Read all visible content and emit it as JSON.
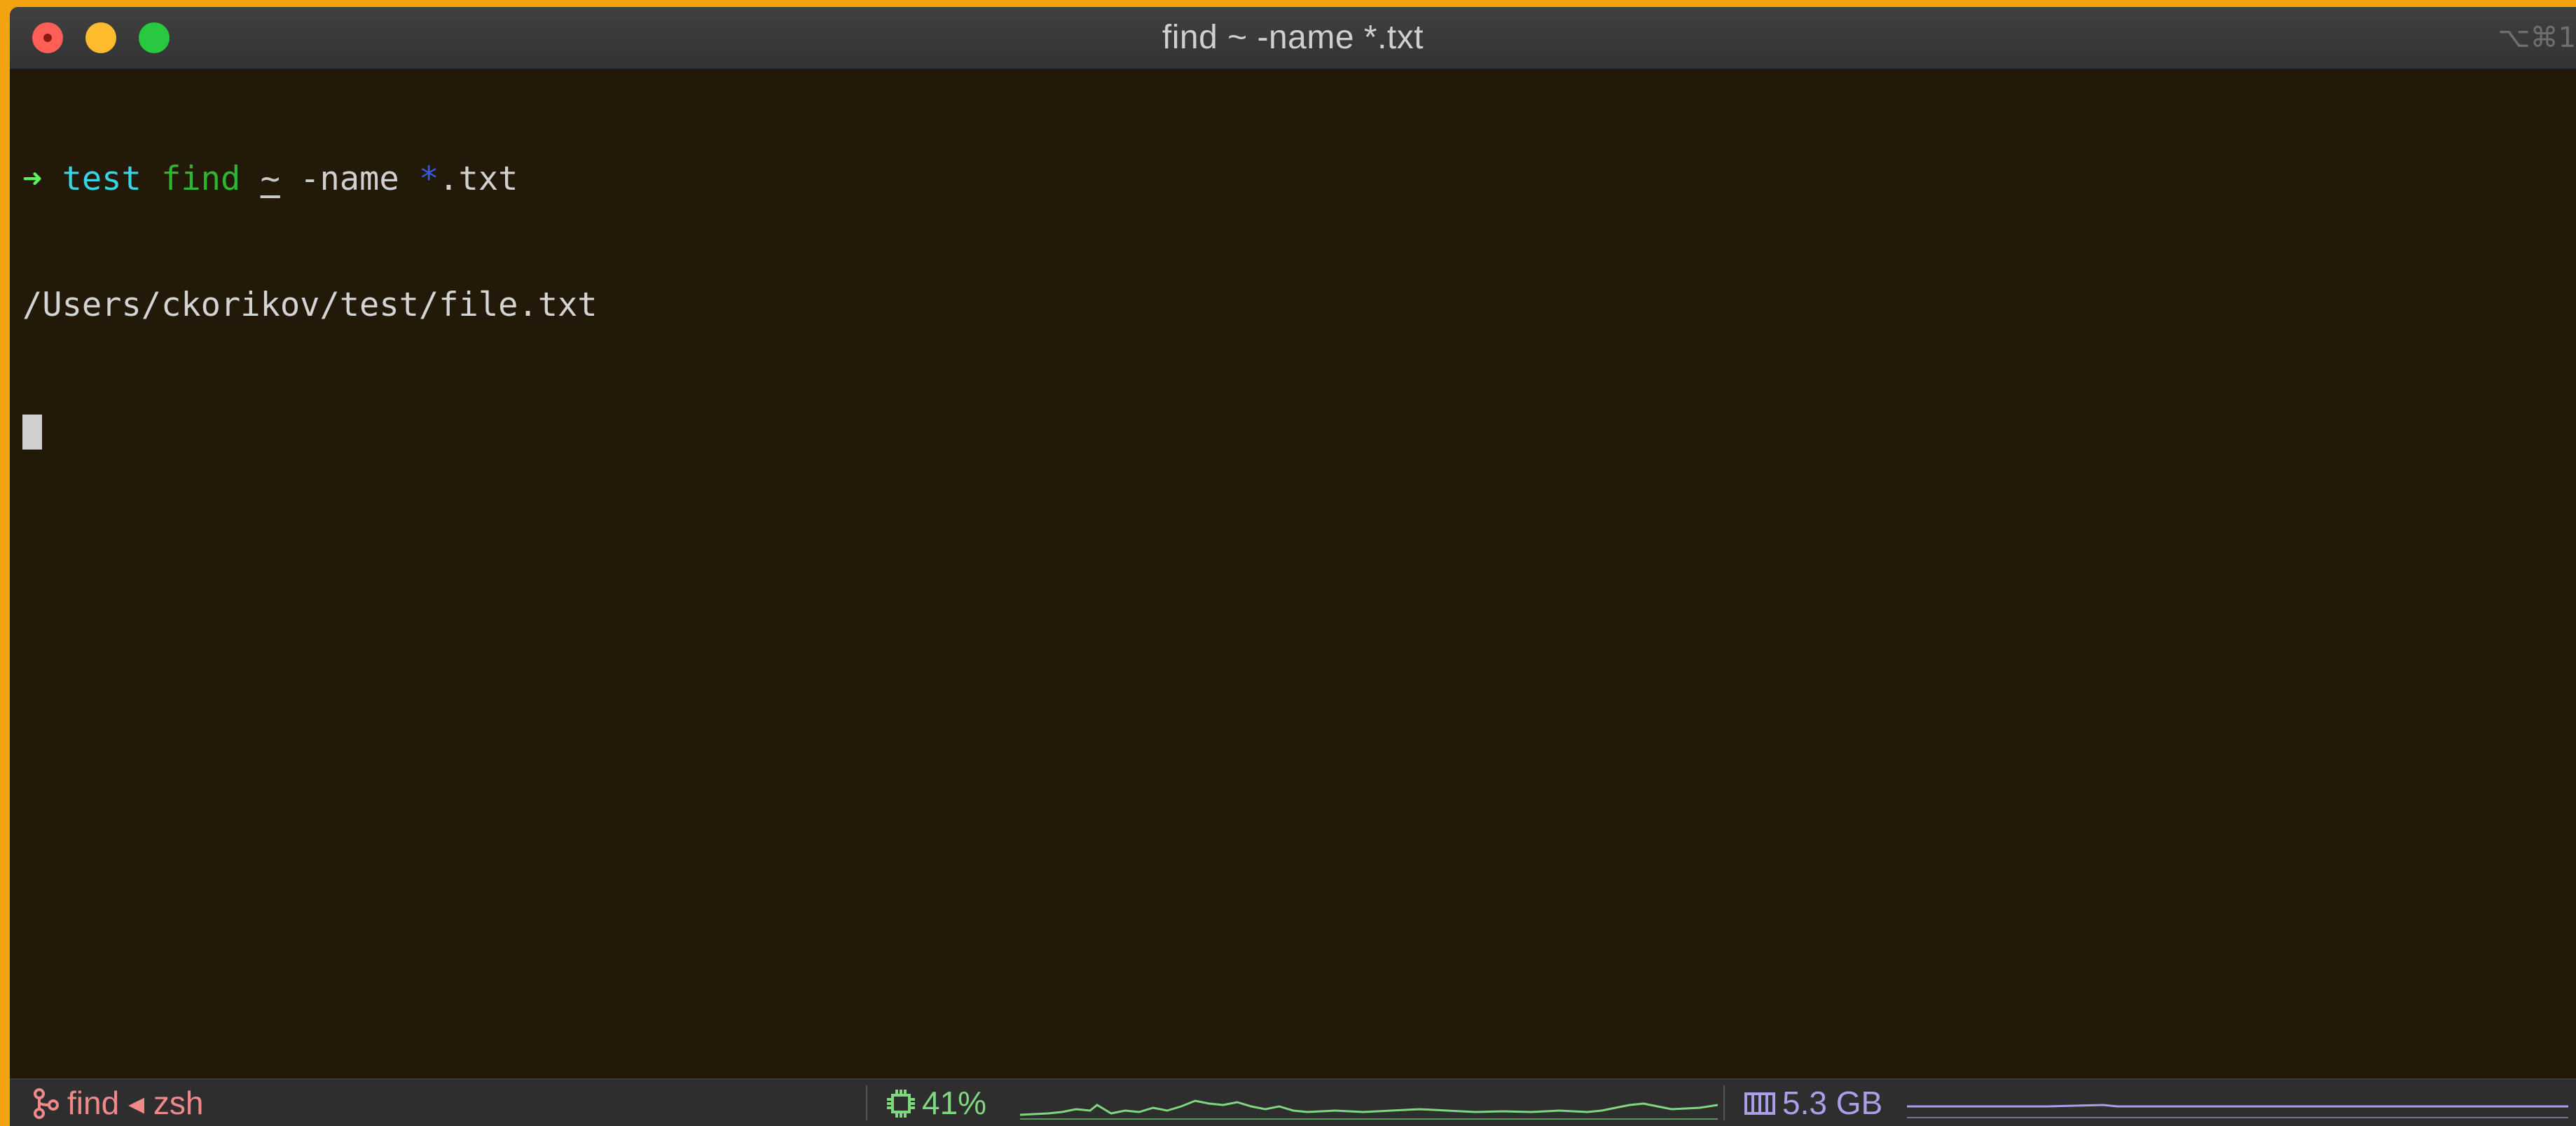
{
  "window": {
    "title": "find ~ -name *.txt",
    "shortcut": "⌥⌘1"
  },
  "terminal": {
    "prompt_arrow": "➜",
    "prompt_dir": "test",
    "cmd_name": "find",
    "cmd_tilde": "~",
    "cmd_flag": "-name",
    "cmd_glob": "*",
    "cmd_ext": ".txt",
    "output": "/Users/ckorikov/test/file.txt"
  },
  "statusbar": {
    "job": "find ◂ zsh",
    "cpu_label": "41%",
    "cpu_percent": 41,
    "mem_label": "5.3 GB",
    "icons": {
      "job": "git-branch-icon",
      "cpu": "cpu-chip-icon",
      "mem": "memory-icon"
    },
    "colors": {
      "job": "#f08a8a",
      "cpu": "#7fd77f",
      "mem": "#a8a0e8"
    }
  }
}
